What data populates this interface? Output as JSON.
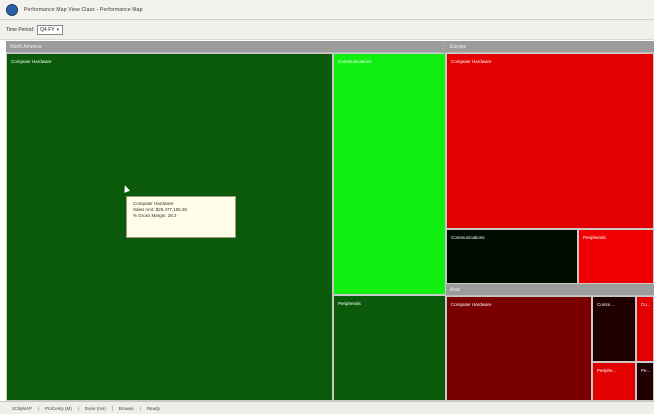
{
  "window": {
    "title": "Performance Map View Class - Performance Map"
  },
  "toolbar": {
    "time_period_label": "Time Period:",
    "time_period_value": "Q4 FY"
  },
  "groups": [
    {
      "name": "North America"
    },
    {
      "name": "Europe"
    },
    {
      "name": "Asia"
    }
  ],
  "cells": [
    {
      "label": "Computer Hardware",
      "color": "#0b5a0b"
    },
    {
      "label": "Communications",
      "color": "#10f010"
    },
    {
      "label": "Peripherals",
      "color": "#0b5a0b"
    },
    {
      "label": "Computer Hardware",
      "color": "#e20000"
    },
    {
      "label": "Communications",
      "color": "#000c00"
    },
    {
      "label": "Peripherals",
      "color": "#f00000"
    },
    {
      "label": "Computer Hardware",
      "color": "#7a0000"
    },
    {
      "label": "Comm...",
      "color": "#1e0000"
    },
    {
      "label": "Periphe...",
      "color": "#e20000"
    },
    {
      "label": "Co...",
      "color": "#e20000"
    },
    {
      "label": "Pe...",
      "color": "#200000"
    }
  ],
  "tooltip": {
    "line1": "Computer Hardware",
    "line2": "Sales Amt: $26,477,195.30",
    "line3": "% Gross Margin: 28.3"
  },
  "statusbar": {
    "items": [
      "2CityMAP",
      "ProCenty (M)",
      "Done (ms)",
      "Browse",
      "Ready"
    ]
  }
}
